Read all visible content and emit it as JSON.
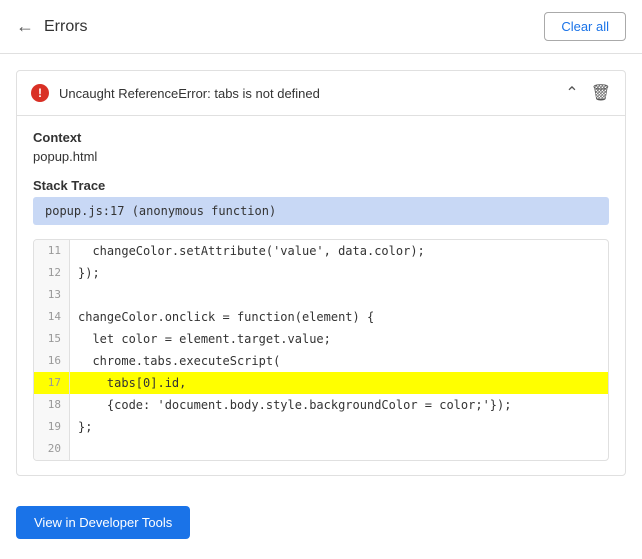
{
  "header": {
    "back_label": "←",
    "title": "Errors",
    "clear_all_label": "Clear all"
  },
  "error": {
    "icon_label": "!",
    "message": "Uncaught ReferenceError: tabs is not defined",
    "context_label": "Context",
    "context_value": "popup.html",
    "stack_trace_label": "Stack Trace",
    "stack_trace_value": "popup.js:17 (anonymous function)",
    "code_lines": [
      {
        "num": "11",
        "content": "  changeColor.setAttribute('value', data.color);",
        "highlight": false
      },
      {
        "num": "12",
        "content": "});",
        "highlight": false
      },
      {
        "num": "13",
        "content": "",
        "highlight": false
      },
      {
        "num": "14",
        "content": "changeColor.onclick = function(element) {",
        "highlight": false
      },
      {
        "num": "15",
        "content": "  let color = element.target.value;",
        "highlight": false
      },
      {
        "num": "16",
        "content": "  chrome.tabs.executeScript(",
        "highlight": false
      },
      {
        "num": "17",
        "content": "    tabs[0].id,",
        "highlight": true
      },
      {
        "num": "18",
        "content": "    {code: 'document.body.style.backgroundColor = color;'});",
        "highlight": false
      },
      {
        "num": "19",
        "content": "};",
        "highlight": false
      },
      {
        "num": "20",
        "content": "",
        "highlight": false
      }
    ]
  },
  "footer": {
    "view_btn_label": "View in Developer Tools"
  }
}
